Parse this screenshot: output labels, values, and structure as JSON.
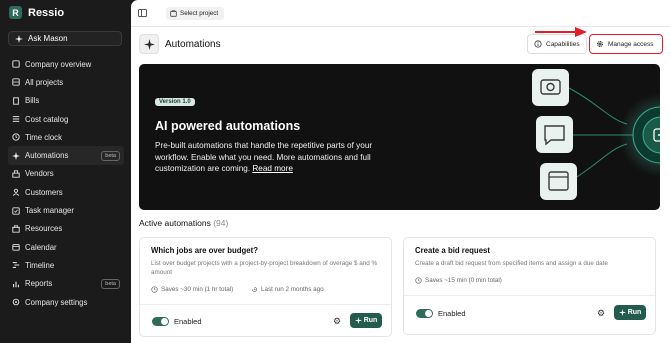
{
  "app": {
    "name": "Ressio",
    "logo_letter": "R"
  },
  "ask": {
    "label": "Ask Mason"
  },
  "nav": [
    {
      "label": "Company overview",
      "icon": "company-icon"
    },
    {
      "label": "All projects",
      "icon": "projects-icon"
    },
    {
      "label": "Bills",
      "icon": "bills-icon"
    },
    {
      "label": "Cost catalog",
      "icon": "catalog-icon"
    },
    {
      "label": "Time clock",
      "icon": "clock-icon"
    },
    {
      "label": "Automations",
      "icon": "automation-icon",
      "badge": "beta",
      "active": true
    },
    {
      "label": "Vendors",
      "icon": "vendors-icon"
    },
    {
      "label": "Customers",
      "icon": "customers-icon"
    },
    {
      "label": "Task manager",
      "icon": "tasks-icon"
    },
    {
      "label": "Resources",
      "icon": "resources-icon"
    },
    {
      "label": "Calendar",
      "icon": "calendar-icon"
    },
    {
      "label": "Timeline",
      "icon": "timeline-icon"
    },
    {
      "label": "Reports",
      "icon": "reports-icon",
      "badge": "beta"
    },
    {
      "label": "Company settings",
      "icon": "settings-icon"
    }
  ],
  "topbar": {
    "select_project": "Select project"
  },
  "header": {
    "title": "Automations",
    "capabilities": "Capabilities",
    "manage_access": "Manage access"
  },
  "hero": {
    "version": "Version 1.0",
    "title": "AI powered automations",
    "description": "Pre-built automations that handle the repetitive parts of your workflow. Enable what you need. More automations and full customization are coming.",
    "read_more": "Read more"
  },
  "section": {
    "title": "Active automations",
    "count": "(94)"
  },
  "cards": [
    {
      "title": "Which jobs are over budget?",
      "description": "List over budget projects with a project-by-project breakdown of overage $ and % amount",
      "saves": "Saves ~30 min (1 hr total)",
      "last_run": "Last run 2 months ago",
      "enabled_label": "Enabled",
      "run_label": "Run"
    },
    {
      "title": "Create a bid request",
      "description": "Create a draft bid request from specified items and assign a due date",
      "saves": "Saves ~15 min (0 min total)",
      "enabled_label": "Enabled",
      "run_label": "Run"
    }
  ],
  "colors": {
    "sidebar_bg": "#1b1b1b",
    "accent": "#235b4d",
    "highlight": "#e21f26"
  }
}
